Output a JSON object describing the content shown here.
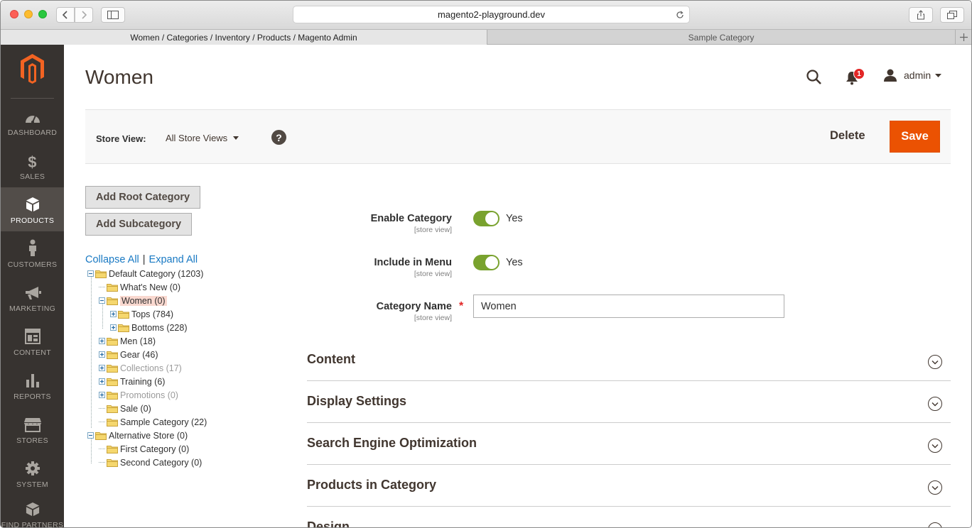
{
  "browser": {
    "url": "magento2-playground.dev",
    "tabs": [
      {
        "label": "Women / Categories / Inventory / Products / Magento Admin"
      },
      {
        "label": "Sample Category"
      }
    ]
  },
  "sidebar": {
    "items": [
      {
        "label": "DASHBOARD",
        "icon": "dashboard-icon"
      },
      {
        "label": "SALES",
        "icon": "dollar-icon"
      },
      {
        "label": "PRODUCTS",
        "icon": "box-icon"
      },
      {
        "label": "CUSTOMERS",
        "icon": "person-icon"
      },
      {
        "label": "MARKETING",
        "icon": "megaphone-icon"
      },
      {
        "label": "CONTENT",
        "icon": "layout-icon"
      },
      {
        "label": "REPORTS",
        "icon": "bar-chart-icon"
      },
      {
        "label": "STORES",
        "icon": "store-icon"
      },
      {
        "label": "SYSTEM",
        "icon": "gear-icon"
      },
      {
        "label": "FIND PARTNERS",
        "icon": "blocks-icon"
      }
    ]
  },
  "header": {
    "title": "Women",
    "notifications_count": "1",
    "user": "admin"
  },
  "actionbar": {
    "store_view_label": "Store View:",
    "store_view_value": "All Store Views",
    "help": "?",
    "delete_label": "Delete",
    "save_label": "Save"
  },
  "tree": {
    "add_root": "Add Root Category",
    "add_sub": "Add Subcategory",
    "collapse_all": "Collapse All",
    "separator": "|",
    "expand_all": "Expand All",
    "nodes": [
      {
        "label": "Default Category (1203)"
      },
      {
        "label": "What's New (0)"
      },
      {
        "label": "Women (0)"
      },
      {
        "label": "Tops (784)"
      },
      {
        "label": "Bottoms (228)"
      },
      {
        "label": "Men (18)"
      },
      {
        "label": "Gear (46)"
      },
      {
        "label": "Collections (17)"
      },
      {
        "label": "Training (6)"
      },
      {
        "label": "Promotions (0)"
      },
      {
        "label": "Sale (0)"
      },
      {
        "label": "Sample Category (22)"
      },
      {
        "label": "Alternative Store (0)"
      },
      {
        "label": "First Category (0)"
      },
      {
        "label": "Second Category (0)"
      }
    ]
  },
  "form": {
    "enable_label": "Enable Category",
    "enable_scope": "[store view]",
    "enable_value": "Yes",
    "menu_label": "Include in Menu",
    "menu_scope": "[store view]",
    "menu_value": "Yes",
    "name_label": "Category Name",
    "name_scope": "[store view]",
    "required_mark": "*",
    "name_value": "Women"
  },
  "sections": [
    {
      "label": "Content"
    },
    {
      "label": "Display Settings"
    },
    {
      "label": "Search Engine Optimization"
    },
    {
      "label": "Products in Category"
    },
    {
      "label": "Design"
    }
  ],
  "colors": {
    "sidebar_bg": "#373330",
    "accent_orange": "#eb5202",
    "toggle_green": "#79a22e",
    "link_blue": "#1979c3"
  }
}
